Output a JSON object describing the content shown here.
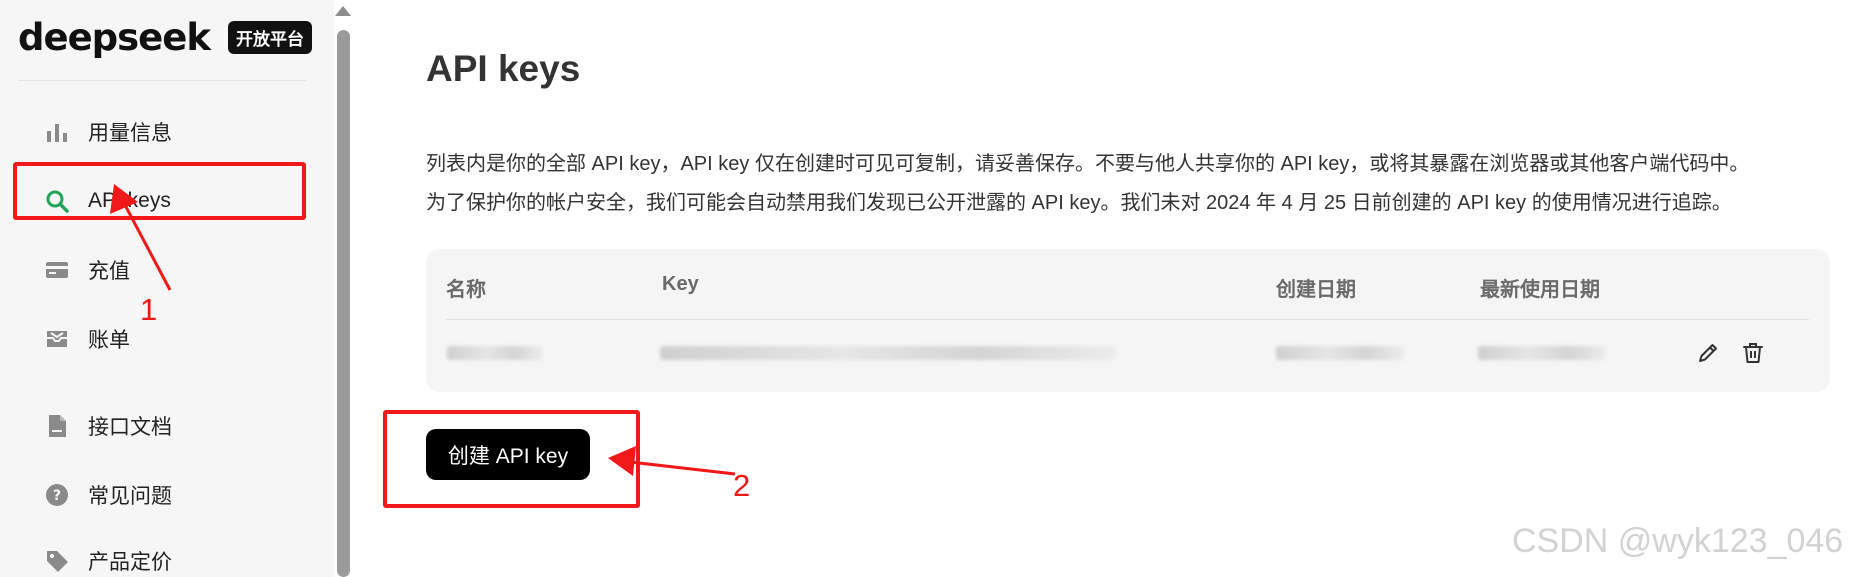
{
  "brand": {
    "name": "deepseek",
    "badge": "开放平台"
  },
  "sidebar": {
    "items": [
      {
        "label": "用量信息",
        "icon": "bar-chart-icon"
      },
      {
        "label": "API keys",
        "icon": "search-icon"
      },
      {
        "label": "充值",
        "icon": "card-icon"
      },
      {
        "label": "账单",
        "icon": "inbox-icon"
      },
      {
        "label": "接口文档",
        "icon": "document-icon"
      },
      {
        "label": "常见问题",
        "icon": "question-icon"
      },
      {
        "label": "产品定价",
        "icon": "tag-icon"
      }
    ]
  },
  "main": {
    "title": "API keys",
    "description": [
      "列表内是你的全部 API key，API key 仅在创建时可见可复制，请妥善保存。不要与他人共享你的 API key，或将其暴露在浏览器或其他客户端代码中。",
      "为了保护你的帐户安全，我们可能会自动禁用我们发现已公开泄露的 API key。我们未对 2024 年 4 月 25 日前创建的 API key 的使用情况进行追踪。"
    ],
    "table": {
      "headers": [
        "名称",
        "Key",
        "创建日期",
        "最新使用日期"
      ],
      "rows": [
        {
          "name": "",
          "key": "",
          "created": "",
          "last_used": ""
        }
      ]
    },
    "create_button": "创建 API key"
  },
  "annotations": {
    "label_1": "1",
    "label_2": "2"
  },
  "watermark": "CSDN @wyk123_046",
  "colors": {
    "accent_green": "#22a35a",
    "annotation_red": "#f01818",
    "button_black": "#000000"
  }
}
